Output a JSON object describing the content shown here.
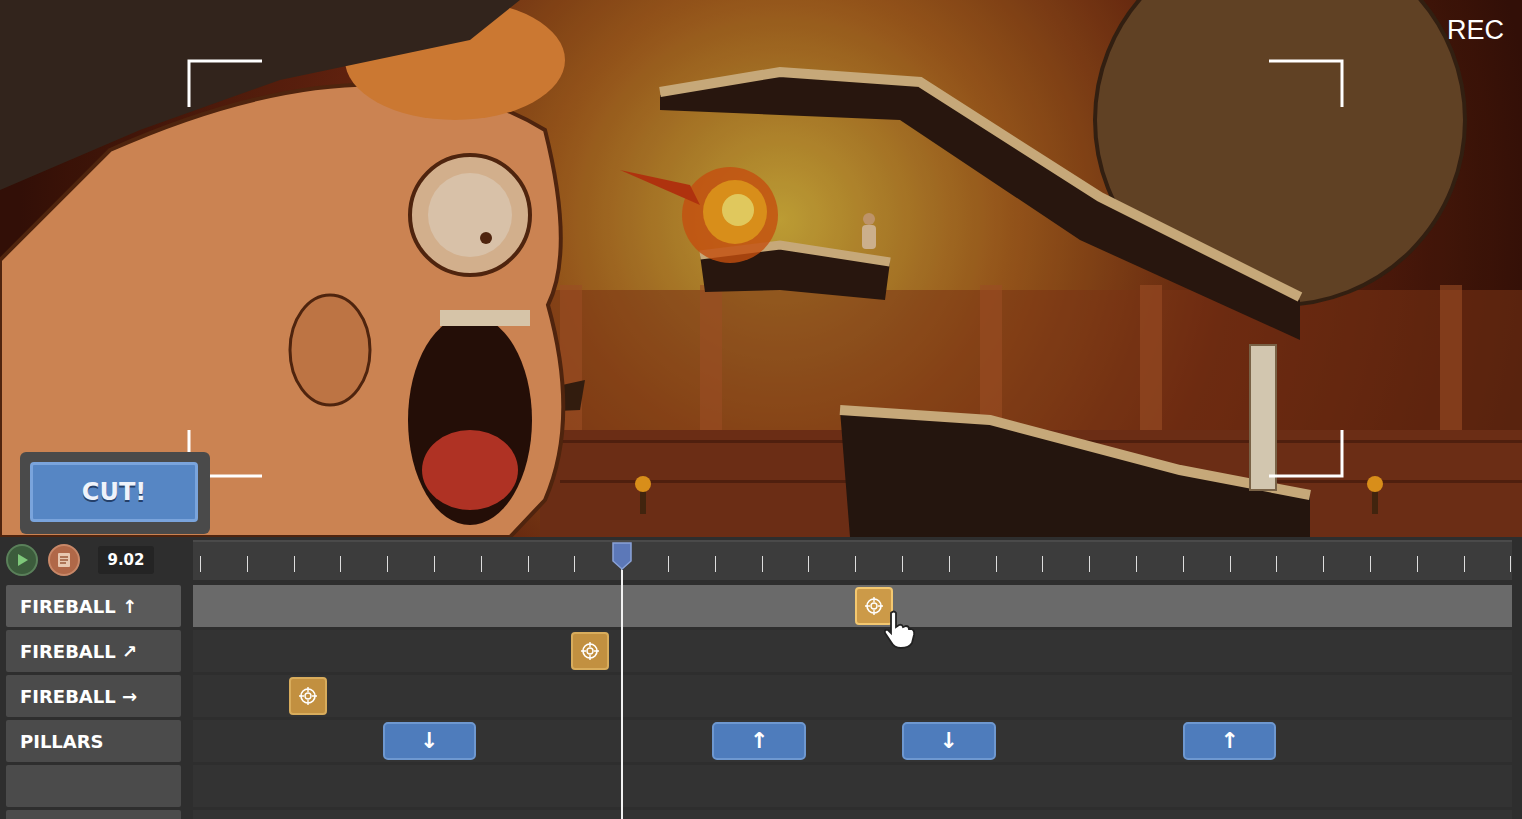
{
  "scene": {
    "recording": "REC",
    "cut_button": "CUT!"
  },
  "timeline": {
    "time": "9.02",
    "tracks": [
      {
        "label": "FIREBALL ↑",
        "selected": true,
        "events": [
          {
            "kind": "fireball",
            "time": 14.4,
            "hovered": true
          }
        ]
      },
      {
        "label": "FIREBALL ↗",
        "selected": false,
        "events": [
          {
            "kind": "fireball",
            "time": 8.33,
            "hovered": false
          }
        ]
      },
      {
        "label": "FIREBALL →",
        "selected": false,
        "events": [
          {
            "kind": "fireball",
            "time": 2.31,
            "hovered": false
          }
        ]
      },
      {
        "label": "PILLARS",
        "selected": false,
        "events": [
          {
            "kind": "pillar",
            "time": 3.9,
            "duration": 2,
            "direction": "↓",
            "hovered": false
          },
          {
            "kind": "pillar",
            "time": 10.95,
            "duration": 2,
            "direction": "↑",
            "hovered": false
          },
          {
            "kind": "pillar",
            "time": 15.0,
            "duration": 2,
            "direction": "↓",
            "hovered": false
          },
          {
            "kind": "pillar",
            "time": 21.0,
            "duration": 2,
            "direction": "↑",
            "hovered": false
          }
        ]
      }
    ]
  }
}
